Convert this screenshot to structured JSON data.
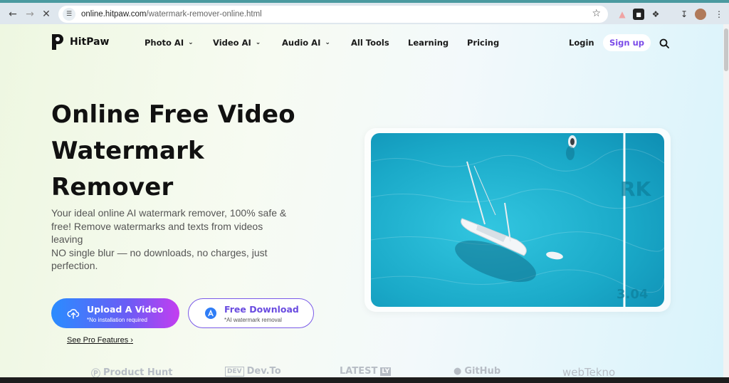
{
  "browser": {
    "url_domain": "online.hitpaw.com",
    "url_path": "/watermark-remover-online.html",
    "back_icon": "arrow-left-icon",
    "forward_icon": "arrow-right-icon",
    "stop_icon": "close-icon"
  },
  "header": {
    "brand": "HitPaw",
    "nav": [
      {
        "label": "Photo AI"
      },
      {
        "label": "Video AI"
      },
      {
        "label": "Audio AI"
      },
      {
        "label": "All Tools"
      },
      {
        "label": "Learning"
      },
      {
        "label": "Pricing"
      }
    ],
    "login": "Login",
    "signup": "Sign up"
  },
  "hero": {
    "title_line1": "Online Free Video",
    "title_line2": "Watermark",
    "title_line3": "Remover",
    "desc_line1": "Your ideal online AI watermark remover, 100% safe &",
    "desc_line2": "free! Remove watermarks and texts from videos",
    "desc_line3": "leaving",
    "desc_line4": "NO single blur — no downloads, no charges, just",
    "desc_line5": "perfection.",
    "upload_label": "Upload A Video",
    "upload_sub": "*No installation required",
    "download_label": "Free Download",
    "download_sub": "*AI watermark removal",
    "pro_link": "See Pro Features",
    "pro_arrow": "›"
  },
  "media": {
    "watermark_text": "RK",
    "timestamp_text": "3.04"
  },
  "press": {
    "items": [
      "Product Hunt",
      "Dev.To",
      "LATEST",
      "GitHub",
      "webTekno"
    ]
  },
  "colors": {
    "accent_purple": "#7a4ae8",
    "upload_gradient_start": "#2a8cff",
    "upload_gradient_end": "#c43df0",
    "water": "#1eb5d3"
  }
}
